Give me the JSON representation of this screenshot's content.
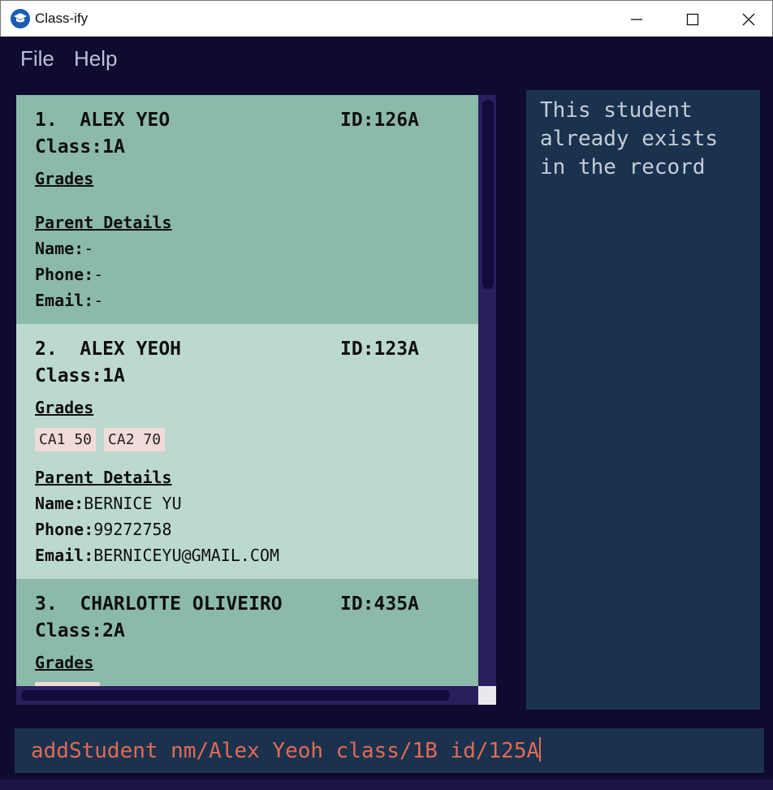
{
  "window": {
    "title": "Class-ify"
  },
  "menu": {
    "file": "File",
    "help": "Help"
  },
  "students": [
    {
      "name": "1.  ALEX YEO",
      "id_label": "ID:",
      "id": "126A",
      "class_label": "Class:",
      "class": "1A",
      "grades_heading": "Grades",
      "grades": [],
      "parent_heading": "Parent Details",
      "parent_name_label": "Name:",
      "parent_name": "-",
      "parent_phone_label": "Phone:",
      "parent_phone": "-",
      "parent_email_label": "Email:",
      "parent_email": "-"
    },
    {
      "name": "2.  ALEX YEOH",
      "id_label": "ID:",
      "id": "123A",
      "class_label": "Class:",
      "class": "1A",
      "grades_heading": "Grades",
      "grades": [
        "CA1 50",
        "CA2 70"
      ],
      "parent_heading": "Parent Details",
      "parent_name_label": "Name:",
      "parent_name": "BERNICE YU",
      "parent_phone_label": "Phone:",
      "parent_phone": "99272758",
      "parent_email_label": "Email:",
      "parent_email": "BERNICEYU@GMAIL.COM"
    },
    {
      "name": "3.  CHARLOTTE OLIVEIRO",
      "id_label": "ID:",
      "id": "435A",
      "class_label": "Class:",
      "class": "2A",
      "grades_heading": "Grades"
    }
  ],
  "result": {
    "message": "This student already exists in the record"
  },
  "command": {
    "value": "addStudent nm/Alex Yeoh class/1B id/125A"
  },
  "colors": {
    "background": "#0e0a30",
    "card_odd": "#8cbaa9",
    "card_even": "#bcd9ce",
    "tag": "#f1dbd9",
    "panel": "#1b324e",
    "command_text": "#e06b55"
  },
  "icons": {
    "app": "graduation-cap-icon",
    "minimize": "minimize-icon",
    "maximize": "maximize-icon",
    "close": "close-icon"
  }
}
